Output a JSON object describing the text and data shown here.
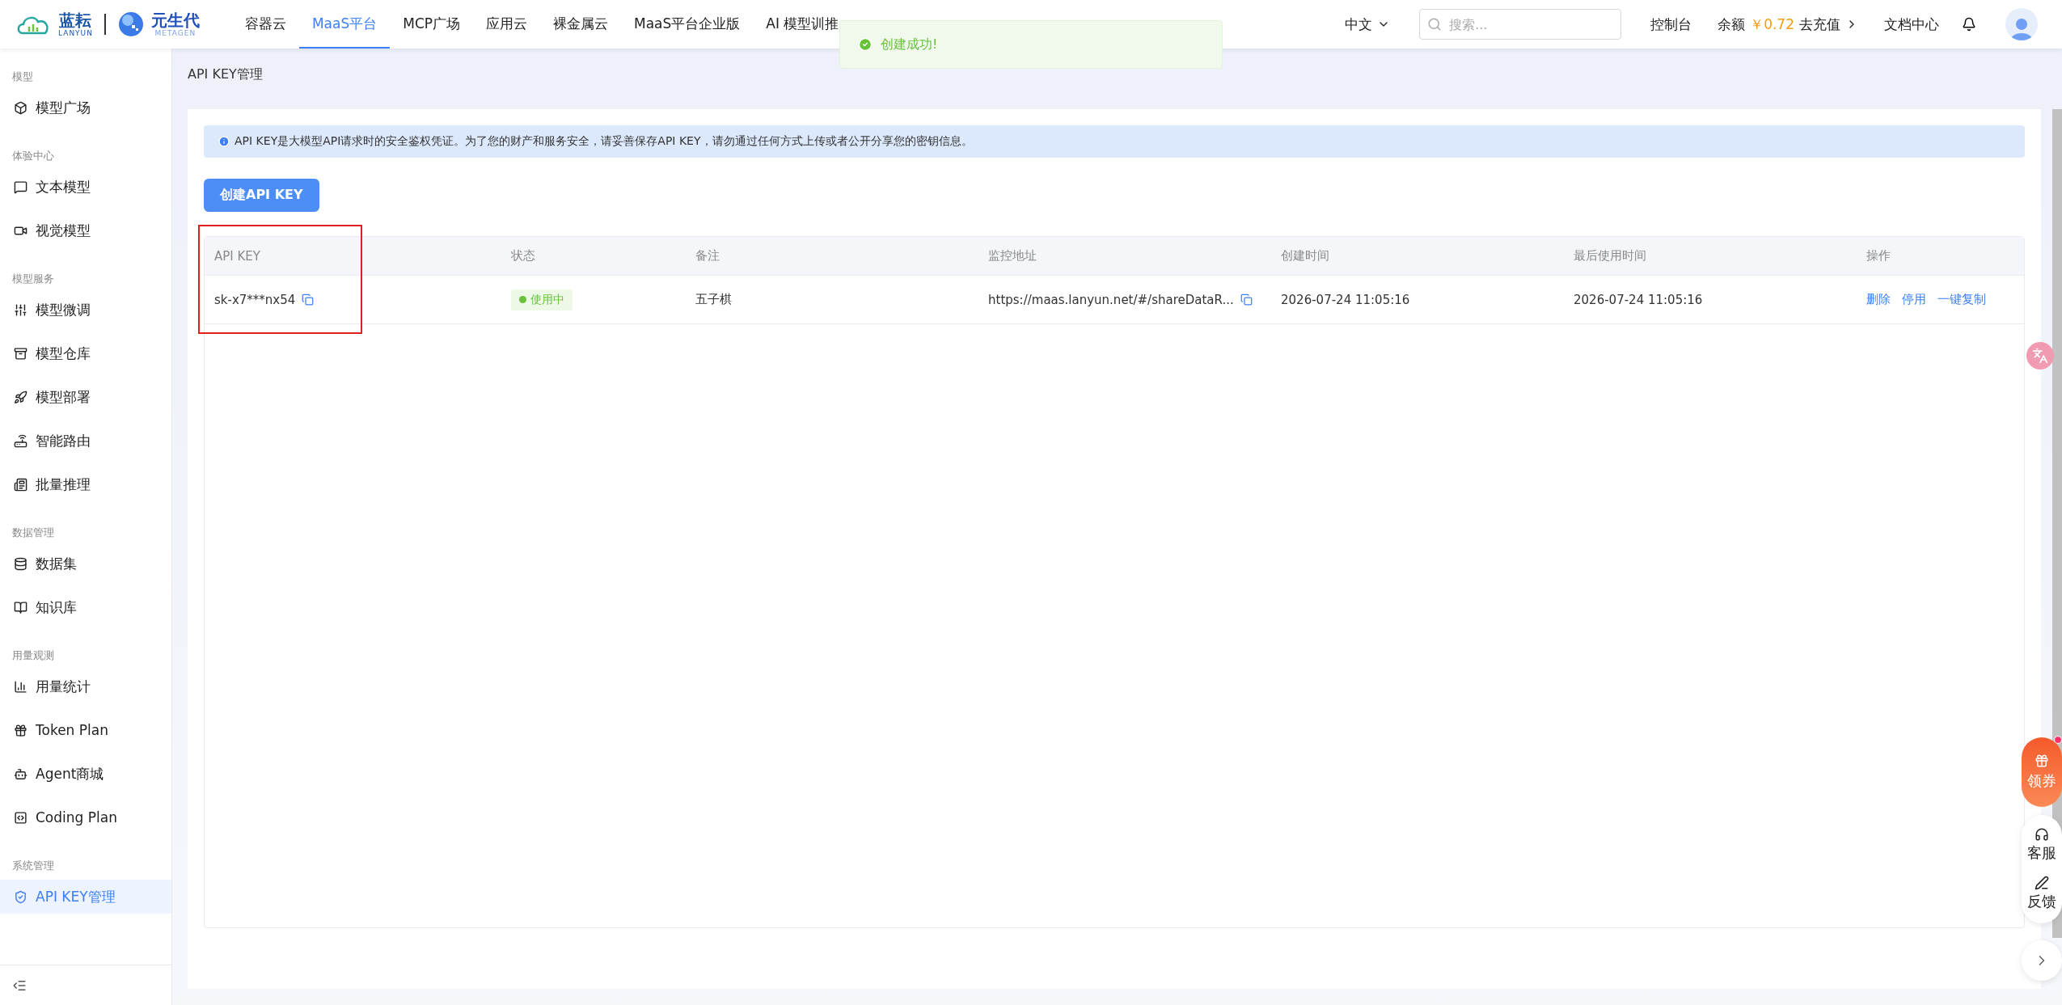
{
  "header": {
    "logo": {
      "brand": "蓝耘",
      "brand_sub": "LANYUN",
      "partner": "元生代",
      "partner_sub": "METAGEN"
    },
    "nav": [
      {
        "label": "容器云",
        "selected": false
      },
      {
        "label": "MaaS平台",
        "selected": true
      },
      {
        "label": "MCP广场",
        "selected": false
      },
      {
        "label": "应用云",
        "selected": false
      },
      {
        "label": "裸金属云",
        "selected": false
      },
      {
        "label": "MaaS平台企业版",
        "selected": false
      },
      {
        "label": "AI 模型训推",
        "selected": false
      }
    ],
    "language": "中文",
    "search": {
      "placeholder": "搜索..."
    },
    "console": "控制台",
    "balance": {
      "label": "余额",
      "amount": "￥0.72",
      "action": "去充值"
    },
    "docs": "文档中心"
  },
  "toast": {
    "message": "创建成功!"
  },
  "sidebar": {
    "sections": [
      {
        "title": "模型",
        "items": [
          {
            "label": "模型广场",
            "selected": false
          }
        ]
      },
      {
        "title": "体验中心",
        "items": [
          {
            "label": "文本模型",
            "selected": false
          },
          {
            "label": "视觉模型",
            "selected": false
          }
        ]
      },
      {
        "title": "模型服务",
        "items": [
          {
            "label": "模型微调",
            "selected": false
          },
          {
            "label": "模型仓库",
            "selected": false
          },
          {
            "label": "模型部署",
            "selected": false
          },
          {
            "label": "智能路由",
            "selected": false
          },
          {
            "label": "批量推理",
            "selected": false
          }
        ]
      },
      {
        "title": "数据管理",
        "items": [
          {
            "label": "数据集",
            "selected": false
          },
          {
            "label": "知识库",
            "selected": false
          }
        ]
      },
      {
        "title": "用量观测",
        "items": [
          {
            "label": "用量统计",
            "selected": false
          },
          {
            "label": "Token Plan",
            "selected": false
          },
          {
            "label": "Agent商城",
            "selected": false
          },
          {
            "label": "Coding Plan",
            "selected": false
          }
        ]
      },
      {
        "title": "系统管理",
        "items": [
          {
            "label": "API KEY管理",
            "selected": true
          }
        ]
      }
    ]
  },
  "page": {
    "title": "API KEY管理",
    "notice": "API KEY是大模型API请求时的安全鉴权凭证。为了您的财产和服务安全，请妥善保存API KEY，请勿通过任何方式上传或者公开分享您的密钥信息。",
    "create_button": "创建API KEY",
    "table": {
      "columns": [
        "API KEY",
        "状态",
        "备注",
        "监控地址",
        "创建时间",
        "最后使用时间",
        "操作"
      ],
      "rows": [
        {
          "api_key": "sk-x7***nx54",
          "status": "使用中",
          "note": "五子棋",
          "monitor_url": "https://maas.lanyun.net/#/shareDataR...",
          "created": "2026-07-24 11:05:16",
          "last_used": "2026-07-24 11:05:16",
          "actions": [
            "删除",
            "停用",
            "一键复制"
          ]
        }
      ]
    }
  },
  "float": {
    "coupon": "领券",
    "service": "客服",
    "feedback": "反馈"
  }
}
